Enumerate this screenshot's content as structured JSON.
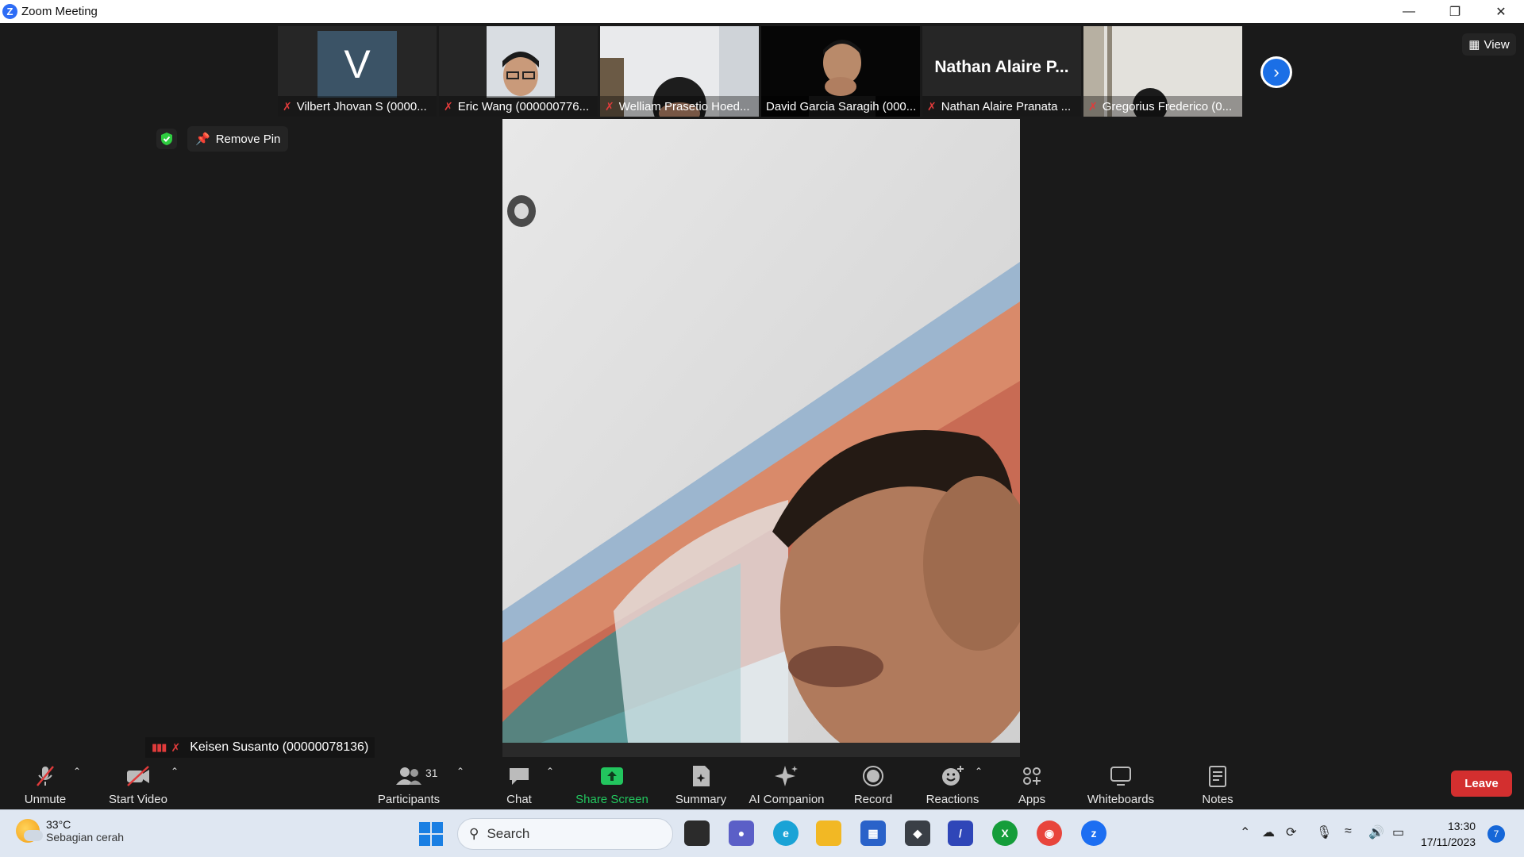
{
  "window": {
    "title": "Zoom Meeting",
    "controls": [
      "minimize",
      "restore",
      "close"
    ]
  },
  "participants_strip": [
    {
      "name": "Vilbert Jhovan S (0000...",
      "avatar_letter": "V",
      "muted": true
    },
    {
      "name": "Eric Wang (000000776...",
      "muted": true
    },
    {
      "name": "Welliam Prasetio Hoed...",
      "muted": true
    },
    {
      "name": "David Garcia Saragih (000...",
      "muted": false
    },
    {
      "name": "Nathan Alaire Pranata ...",
      "display_name": "Nathan  Alaire  P...",
      "muted": true
    },
    {
      "name": "Gregorius Frederico (0...",
      "muted": true
    }
  ],
  "view_button": {
    "label": "View",
    "icon": "grid-icon"
  },
  "pin": {
    "remove_label": "Remove Pin",
    "icon": "pin-icon"
  },
  "security_icon": "shield-check-icon",
  "active_speaker": {
    "name": "Keisen Susanto (00000078136)",
    "muted": true
  },
  "toolbar": {
    "unmute": "Unmute",
    "start_video": "Start Video",
    "participants": "Participants",
    "participants_count": "31",
    "chat": "Chat",
    "share_screen": "Share Screen",
    "summary": "Summary",
    "ai_companion": "AI Companion",
    "record": "Record",
    "reactions": "Reactions",
    "apps": "Apps",
    "whiteboards": "Whiteboards",
    "notes": "Notes",
    "leave": "Leave"
  },
  "colors": {
    "leave": "#d32f2f",
    "share_screen": "#22c55e",
    "accent": "#1b6fe6",
    "muted": "#e03b3b"
  },
  "taskbar": {
    "weather_temp": "33°C",
    "weather_desc": "Sebagian cerah",
    "search_placeholder": "Search",
    "time": "13:30",
    "date": "17/11/2023",
    "notification_count": "7"
  }
}
